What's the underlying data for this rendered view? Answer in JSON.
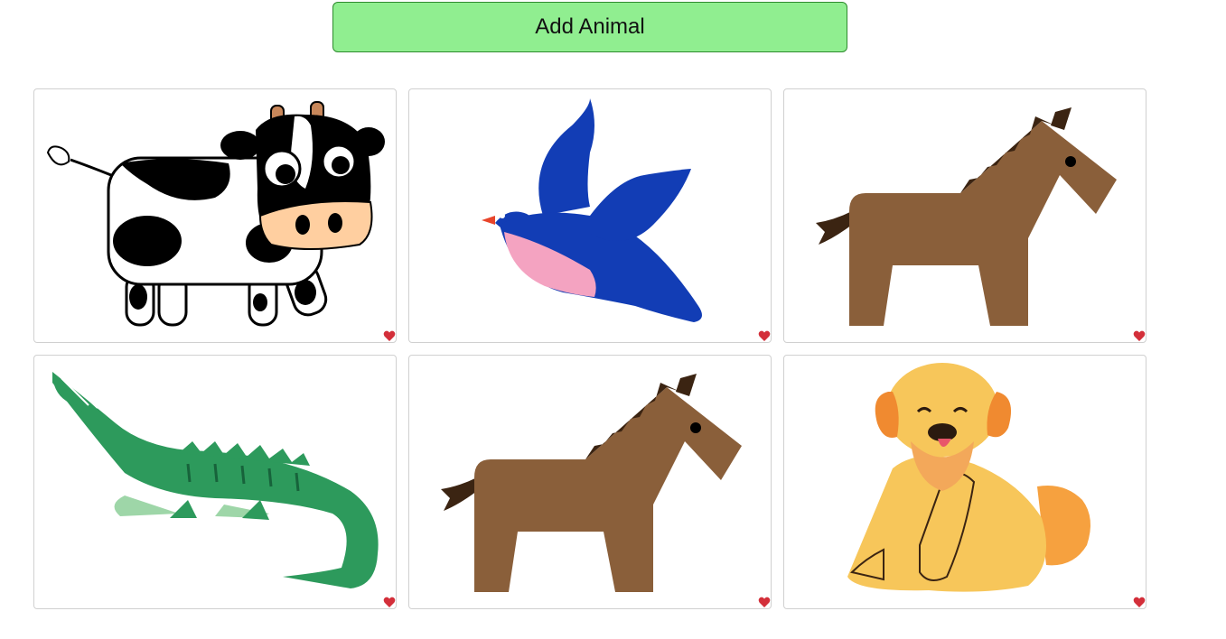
{
  "toolbar": {
    "add_label": "Add Animal"
  },
  "colors": {
    "button_bg": "#90ee90",
    "heart": "#d32f3a"
  },
  "cards": [
    {
      "animal": "cow-icon",
      "favorite": true
    },
    {
      "animal": "bird-icon",
      "favorite": true
    },
    {
      "animal": "horse-icon",
      "favorite": true
    },
    {
      "animal": "crocodile-icon",
      "favorite": true
    },
    {
      "animal": "horse-icon",
      "favorite": true
    },
    {
      "animal": "dog-icon",
      "favorite": true
    }
  ]
}
